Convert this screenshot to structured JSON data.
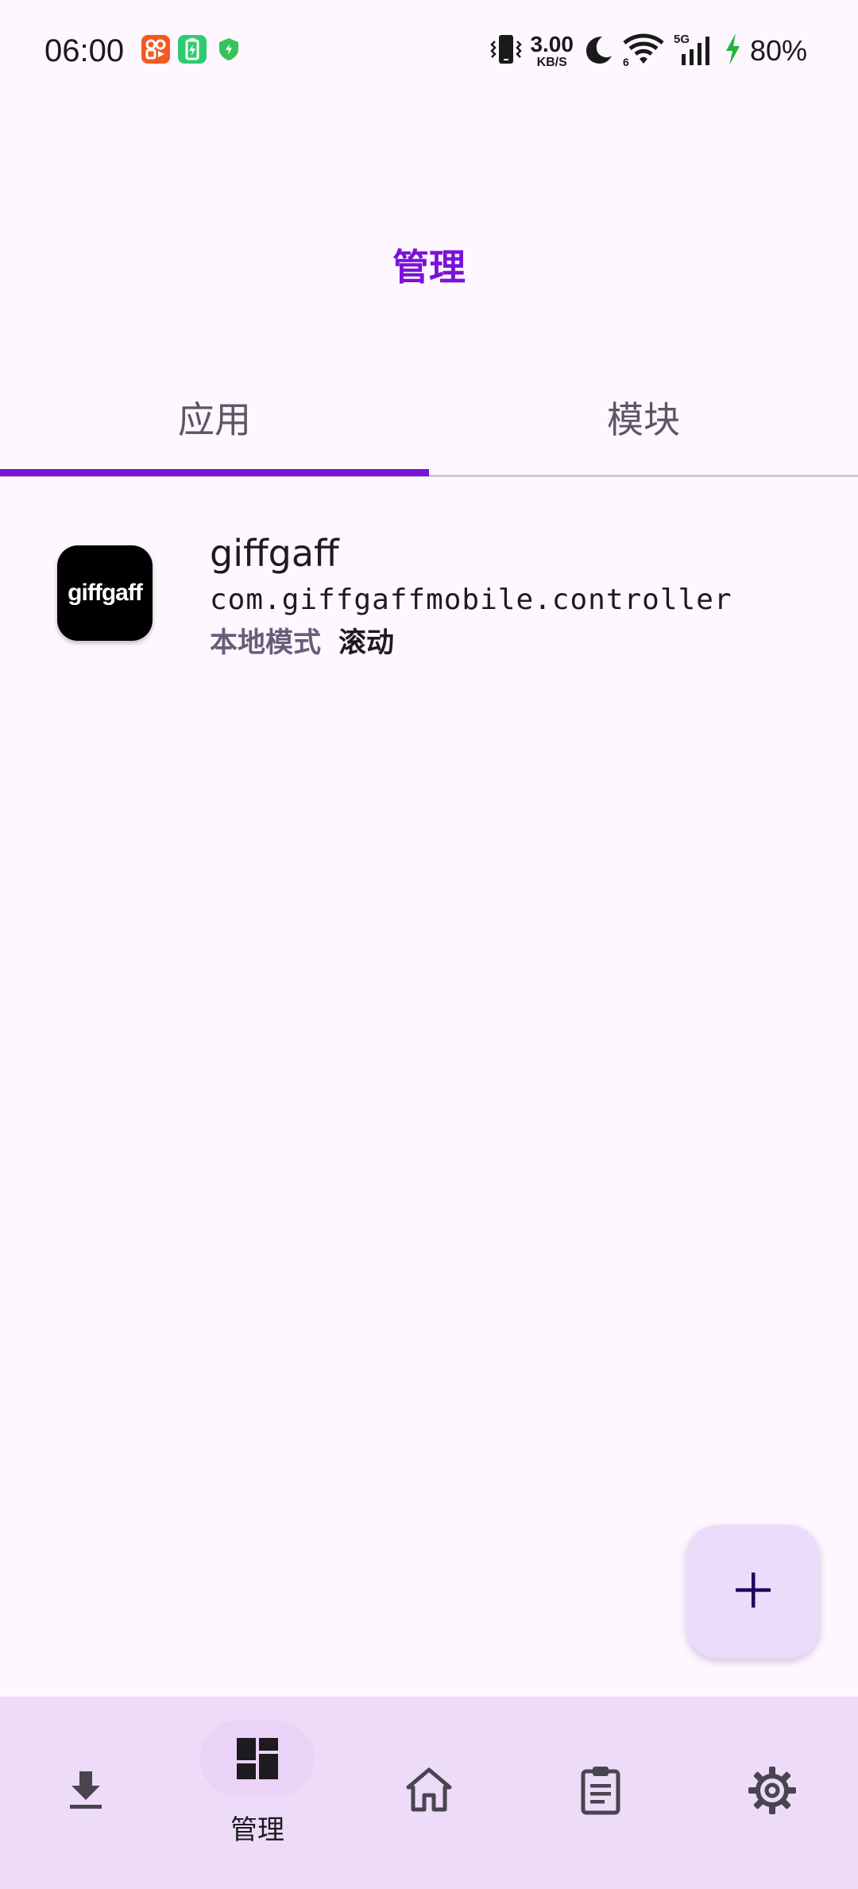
{
  "status_bar": {
    "time": "06:00",
    "net_speed_value": "3.00",
    "net_speed_unit": "KB/S",
    "battery_percent": "80%",
    "icons": [
      "app-notification-icon",
      "battery-saver-notification-icon",
      "shield-notification-icon",
      "vibrate-icon",
      "moon-icon",
      "wifi-icon",
      "signal-5g-icon",
      "charging-icon"
    ]
  },
  "header": {
    "title": "管理"
  },
  "tabs": [
    {
      "label": "应用",
      "selected": true
    },
    {
      "label": "模块",
      "selected": false
    }
  ],
  "apps": [
    {
      "icon_text": "giffgaff",
      "name": "giffgaff",
      "package": "com.giffgaffmobile.controller",
      "mode": "本地模式",
      "scope": "滚动"
    }
  ],
  "fab": {
    "icon": "plus-icon"
  },
  "bottom_nav": {
    "items": [
      {
        "icon": "download-icon",
        "label": ""
      },
      {
        "icon": "dashboard-icon",
        "label": "管理",
        "selected": true
      },
      {
        "icon": "home-icon",
        "label": ""
      },
      {
        "icon": "clipboard-icon",
        "label": ""
      },
      {
        "icon": "gear-icon",
        "label": ""
      }
    ]
  },
  "colors": {
    "background": "#fef7ff",
    "accent": "#7a12d8",
    "nav_background": "#eedbf8",
    "fab_background": "#eadcfa"
  }
}
